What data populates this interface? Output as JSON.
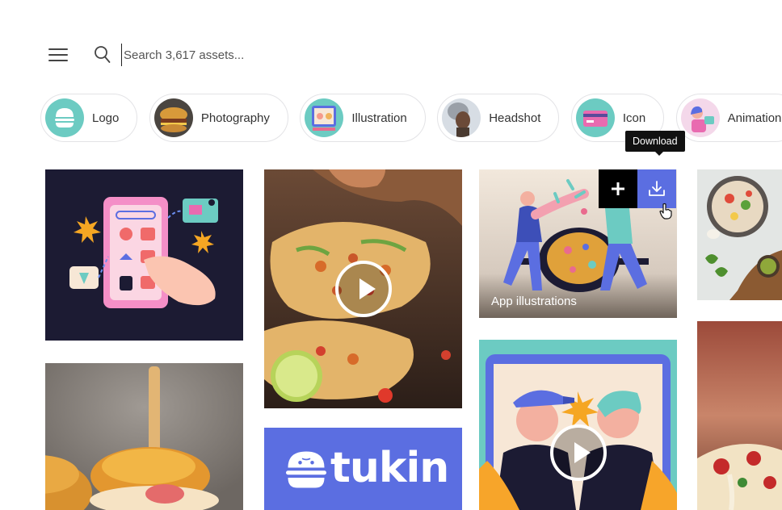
{
  "search": {
    "placeholder": "Search 3,617 assets..."
  },
  "categories": [
    {
      "label": "Logo"
    },
    {
      "label": "Photography"
    },
    {
      "label": "Illustration"
    },
    {
      "label": "Headshot"
    },
    {
      "label": "Icon"
    },
    {
      "label": "Animation"
    }
  ],
  "tooltip": {
    "text": "Download"
  },
  "cards": {
    "app_illustrations": {
      "caption": "App illustrations"
    },
    "tukin_logo": {
      "text": "tukin"
    }
  },
  "colors": {
    "accent": "#5b6ee1",
    "chip_border": "#e3e3e6",
    "navy": "#1c1b33",
    "teal": "#6ccbc2"
  }
}
